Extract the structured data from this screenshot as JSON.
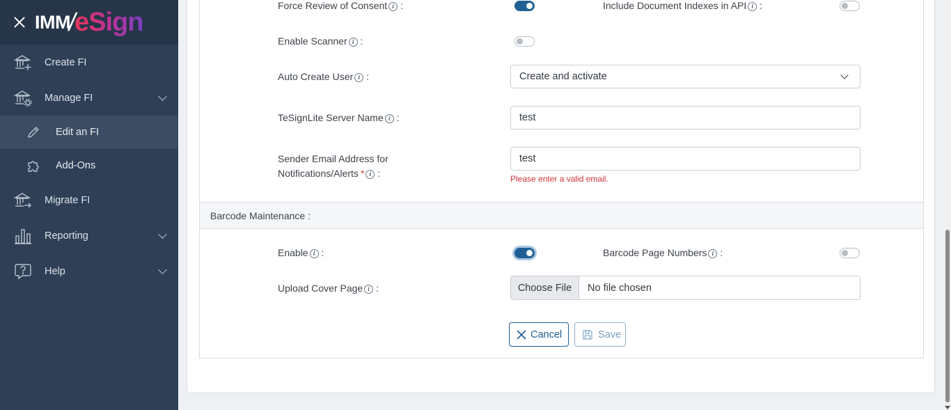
{
  "app": {
    "logo_left": "IMM",
    "logo_right": "eSign"
  },
  "sidebar": {
    "items": [
      {
        "label": "Create FI",
        "icon": "bank-plus-icon"
      },
      {
        "label": "Manage FI",
        "icon": "bank-gear-icon",
        "expanded": true
      },
      {
        "label": "Edit an FI",
        "icon": "pencil-icon",
        "active": true
      },
      {
        "label": "Add-Ons",
        "icon": "puzzle-icon"
      },
      {
        "label": "Migrate FI",
        "icon": "bank-arrow-icon"
      },
      {
        "label": "Reporting",
        "icon": "bar-chart-icon"
      },
      {
        "label": "Help",
        "icon": "help-icon"
      }
    ]
  },
  "form": {
    "force_review_label": "Force Review of Consent",
    "force_review_on": true,
    "include_doc_indexes_label": "Include Document Indexes in API",
    "include_doc_indexes_on": false,
    "enable_scanner_label": "Enable Scanner",
    "enable_scanner_on": false,
    "auto_create_user_label": "Auto Create User",
    "auto_create_user_value": "Create and activate",
    "server_name_label": "TeSignLite Server Name",
    "server_name_value": "test",
    "sender_email_label_line1": "Sender Email Address for",
    "sender_email_label_line2": "Notifications/Alerts",
    "sender_email_required": "*",
    "sender_email_value": "test",
    "sender_email_error": "Please enter a valid email.",
    "colon": ":",
    "info_glyph": "i"
  },
  "barcode": {
    "section_title": "Barcode Maintenance :",
    "enable_label": "Enable",
    "enable_on": true,
    "page_numbers_label": "Barcode Page Numbers",
    "page_numbers_on": false,
    "upload_cover_label": "Upload Cover Page",
    "choose_file_label": "Choose File",
    "no_file_text": "No file chosen"
  },
  "actions": {
    "cancel_label": "Cancel",
    "save_label": "Save"
  },
  "colors": {
    "sidebar_bg": "#2e3f56",
    "accent": "#1f5f94",
    "error": "#d0343a"
  }
}
